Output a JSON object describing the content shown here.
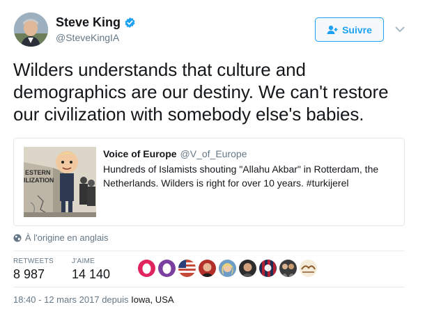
{
  "author": {
    "name": "Steve King",
    "handle": "@SteveKingIA"
  },
  "follow_button": {
    "label": "Suivre"
  },
  "tweet": {
    "text": "Wilders understands that culture and demographics are our destiny. We can't restore our civilization with somebody else's babies."
  },
  "quoted_tweet": {
    "name": "Voice of Europe",
    "handle": "@V_of_Europe",
    "text": "Hundreds of Islamists shouting \"Allahu Akbar\" in Rotterdam, the Netherlands. Wilders is right for over 10 years. #turkijerel",
    "image_text": "ESTERN\nILIZATION"
  },
  "translate": {
    "label": "À l'origine en anglais"
  },
  "stats": {
    "retweets_label": "RETWEETS",
    "retweets_value": "8 987",
    "likes_label": "J'AIME",
    "likes_value": "14 140"
  },
  "meta": {
    "time": "18:40 - 12 mars 2017 depuis",
    "location": "Iowa, USA"
  },
  "colors": {
    "link_blue": "#1da1f2",
    "secondary_text": "#657786",
    "primary_text": "#14171a",
    "border": "#e1e8ed"
  }
}
